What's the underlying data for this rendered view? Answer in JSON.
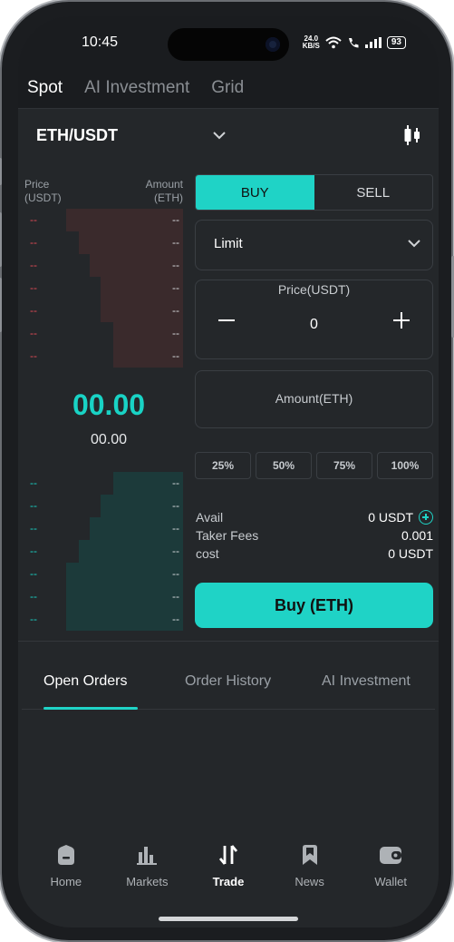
{
  "status_bar": {
    "time": "10:45",
    "net_speed_value": "24.0",
    "net_speed_unit": "KB/S",
    "battery": "93"
  },
  "top_tabs": [
    "Spot",
    "AI Investment",
    "Grid"
  ],
  "pair": {
    "symbol": "ETH/USDT"
  },
  "orderbook": {
    "price_header": [
      "Price",
      "(USDT)"
    ],
    "amount_header": [
      "Amount",
      "(ETH)"
    ],
    "asks": [
      {
        "price": "--",
        "amount": "--",
        "depth": 0.74
      },
      {
        "price": "--",
        "amount": "--",
        "depth": 0.66
      },
      {
        "price": "--",
        "amount": "--",
        "depth": 0.59
      },
      {
        "price": "--",
        "amount": "--",
        "depth": 0.52
      },
      {
        "price": "--",
        "amount": "--",
        "depth": 0.52
      },
      {
        "price": "--",
        "amount": "--",
        "depth": 0.44
      },
      {
        "price": "--",
        "amount": "--",
        "depth": 0.44
      }
    ],
    "last_price": "00.00",
    "last_price_sub": "00.00",
    "bids": [
      {
        "price": "--",
        "amount": "--",
        "depth": 0.44
      },
      {
        "price": "--",
        "amount": "--",
        "depth": 0.52
      },
      {
        "price": "--",
        "amount": "--",
        "depth": 0.59
      },
      {
        "price": "--",
        "amount": "--",
        "depth": 0.66
      },
      {
        "price": "--",
        "amount": "--",
        "depth": 0.74
      },
      {
        "price": "--",
        "amount": "--",
        "depth": 0.74
      },
      {
        "price": "--",
        "amount": "--",
        "depth": 0.74
      }
    ]
  },
  "trade": {
    "buy_label": "BUY",
    "sell_label": "SELL",
    "order_type": "Limit",
    "price_label": "Price(USDT)",
    "price_value": "0",
    "amount_placeholder": "Amount(ETH)",
    "percentages": [
      "25%",
      "50%",
      "75%",
      "100%"
    ],
    "avail_label": "Avail",
    "avail_value": "0 USDT",
    "taker_fees_label": "Taker Fees",
    "taker_fees_value": "0.001",
    "cost_label": "cost",
    "cost_value": "0 USDT",
    "submit_label": "Buy (ETH)"
  },
  "order_tabs": [
    "Open Orders",
    "Order History",
    "AI Investment"
  ],
  "bottom_nav": [
    "Home",
    "Markets",
    "Trade",
    "News",
    "Wallet"
  ],
  "colors": {
    "accent": "#1fd3c6",
    "ask": "#e24b56",
    "bg": "#24272a"
  }
}
